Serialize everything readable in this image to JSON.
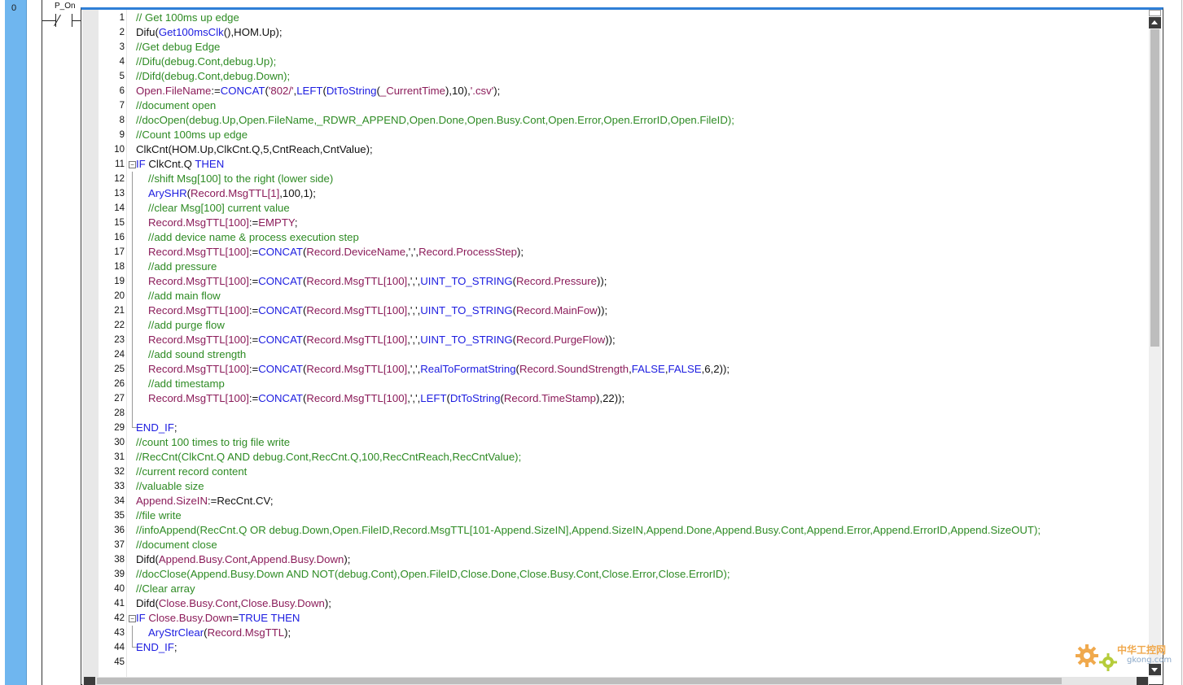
{
  "rung": {
    "number": "0",
    "contact_label": "P_On"
  },
  "colors": {
    "comment": "#2e8b24",
    "keyword": "#1d1de0",
    "variable": "#8b1c5a",
    "rung_bar": "#6fb6ef",
    "editor_border": "#2f7fd7"
  },
  "watermark": {
    "line1": "中华工控网",
    "line2": "gkong.com"
  },
  "code_lines": [
    {
      "n": "1",
      "ind": 0,
      "tk": [
        [
          "c",
          "// Get 100ms up edge"
        ]
      ]
    },
    {
      "n": "2",
      "ind": 0,
      "tk": [
        [
          "p",
          "Difu("
        ],
        [
          "k",
          "Get100msClk"
        ],
        [
          "p",
          "(),HOM.Up);"
        ]
      ]
    },
    {
      "n": "3",
      "ind": 0,
      "tk": [
        [
          "c",
          "//Get debug Edge"
        ]
      ]
    },
    {
      "n": "4",
      "ind": 0,
      "tk": [
        [
          "c",
          "//Difu(debug.Cont,debug.Up);"
        ]
      ]
    },
    {
      "n": "5",
      "ind": 0,
      "tk": [
        [
          "c",
          "//Difd(debug.Cont,debug.Down);"
        ]
      ]
    },
    {
      "n": "6",
      "ind": 0,
      "tk": [
        [
          "v",
          "Open.FileName"
        ],
        [
          "p",
          ":="
        ],
        [
          "k",
          "CONCAT"
        ],
        [
          "p",
          "("
        ],
        [
          "s",
          "'802/'"
        ],
        [
          "p",
          ","
        ],
        [
          "k",
          "LEFT"
        ],
        [
          "p",
          "("
        ],
        [
          "k",
          "DtToString"
        ],
        [
          "p",
          "("
        ],
        [
          "v",
          "_CurrentTime"
        ],
        [
          "p",
          "),10),"
        ],
        [
          "s",
          "'.csv'"
        ],
        [
          "p",
          ");"
        ]
      ]
    },
    {
      "n": "7",
      "ind": 0,
      "tk": [
        [
          "c",
          "//document open"
        ]
      ]
    },
    {
      "n": "8",
      "ind": 0,
      "tk": [
        [
          "c",
          "//docOpen(debug.Up,Open.FileName,_RDWR_APPEND,Open.Done,Open.Busy.Cont,Open.Error,Open.ErrorID,Open.FileID);"
        ]
      ]
    },
    {
      "n": "9",
      "ind": 0,
      "tk": [
        [
          "c",
          "//Count 100ms up edge"
        ]
      ]
    },
    {
      "n": "10",
      "ind": 0,
      "tk": [
        [
          "p",
          "ClkCnt(HOM.Up,ClkCnt.Q,5,CntReach,CntValue);"
        ]
      ]
    },
    {
      "n": "11",
      "ind": 0,
      "fold": "start",
      "tk": [
        [
          "k",
          "IF "
        ],
        [
          "p",
          "ClkCnt.Q "
        ],
        [
          "k",
          "THEN"
        ]
      ]
    },
    {
      "n": "12",
      "ind": 1,
      "fold": "mid",
      "tk": [
        [
          "c",
          "//shift Msg[100] to the right (lower side)"
        ]
      ]
    },
    {
      "n": "13",
      "ind": 1,
      "fold": "mid",
      "tk": [
        [
          "k",
          "ArySHR"
        ],
        [
          "p",
          "("
        ],
        [
          "v",
          "Record.MsgTTL[1]"
        ],
        [
          "p",
          ",100,1);"
        ]
      ]
    },
    {
      "n": "14",
      "ind": 1,
      "fold": "mid",
      "tk": [
        [
          "c",
          "//clear Msg[100] current value"
        ]
      ]
    },
    {
      "n": "15",
      "ind": 1,
      "fold": "mid",
      "tk": [
        [
          "v",
          "Record.MsgTTL[100]"
        ],
        [
          "p",
          ":="
        ],
        [
          "v",
          "EMPTY"
        ],
        [
          "p",
          ";"
        ]
      ]
    },
    {
      "n": "16",
      "ind": 1,
      "fold": "mid",
      "tk": [
        [
          "c",
          "//add device name & process execution step"
        ]
      ]
    },
    {
      "n": "17",
      "ind": 1,
      "fold": "mid",
      "tk": [
        [
          "v",
          "Record.MsgTTL[100]"
        ],
        [
          "p",
          ":="
        ],
        [
          "k",
          "CONCAT"
        ],
        [
          "p",
          "("
        ],
        [
          "v",
          "Record.DeviceName"
        ],
        [
          "p",
          ",',',"
        ],
        [
          "v",
          "Record.ProcessStep"
        ],
        [
          "p",
          ");"
        ]
      ]
    },
    {
      "n": "18",
      "ind": 1,
      "fold": "mid",
      "tk": [
        [
          "c",
          "//add pressure"
        ]
      ]
    },
    {
      "n": "19",
      "ind": 1,
      "fold": "mid",
      "tk": [
        [
          "v",
          "Record.MsgTTL[100]"
        ],
        [
          "p",
          ":="
        ],
        [
          "k",
          "CONCAT"
        ],
        [
          "p",
          "("
        ],
        [
          "v",
          "Record.MsgTTL[100]"
        ],
        [
          "p",
          ",',',"
        ],
        [
          "k",
          "UINT_TO_STRING"
        ],
        [
          "p",
          "("
        ],
        [
          "v",
          "Record.Pressure"
        ],
        [
          "p",
          "));"
        ]
      ]
    },
    {
      "n": "20",
      "ind": 1,
      "fold": "mid",
      "tk": [
        [
          "c",
          "//add main flow"
        ]
      ]
    },
    {
      "n": "21",
      "ind": 1,
      "fold": "mid",
      "tk": [
        [
          "v",
          "Record.MsgTTL[100]"
        ],
        [
          "p",
          ":="
        ],
        [
          "k",
          "CONCAT"
        ],
        [
          "p",
          "("
        ],
        [
          "v",
          "Record.MsgTTL[100]"
        ],
        [
          "p",
          ",',',"
        ],
        [
          "k",
          "UINT_TO_STRING"
        ],
        [
          "p",
          "("
        ],
        [
          "v",
          "Record.MainFow"
        ],
        [
          "p",
          "));"
        ]
      ]
    },
    {
      "n": "22",
      "ind": 1,
      "fold": "mid",
      "tk": [
        [
          "c",
          "//add purge flow"
        ]
      ]
    },
    {
      "n": "23",
      "ind": 1,
      "fold": "mid",
      "tk": [
        [
          "v",
          "Record.MsgTTL[100]"
        ],
        [
          "p",
          ":="
        ],
        [
          "k",
          "CONCAT"
        ],
        [
          "p",
          "("
        ],
        [
          "v",
          "Record.MsgTTL[100]"
        ],
        [
          "p",
          ",',',"
        ],
        [
          "k",
          "UINT_TO_STRING"
        ],
        [
          "p",
          "("
        ],
        [
          "v",
          "Record.PurgeFlow"
        ],
        [
          "p",
          "));"
        ]
      ]
    },
    {
      "n": "24",
      "ind": 1,
      "fold": "mid",
      "tk": [
        [
          "c",
          "//add sound strength"
        ]
      ]
    },
    {
      "n": "25",
      "ind": 1,
      "fold": "mid",
      "tk": [
        [
          "v",
          "Record.MsgTTL[100]"
        ],
        [
          "p",
          ":="
        ],
        [
          "k",
          "CONCAT"
        ],
        [
          "p",
          "("
        ],
        [
          "v",
          "Record.MsgTTL[100]"
        ],
        [
          "p",
          ",',',"
        ],
        [
          "k",
          "RealToFormatString"
        ],
        [
          "p",
          "("
        ],
        [
          "v",
          "Record.SoundStrength"
        ],
        [
          "p",
          ","
        ],
        [
          "k",
          "FALSE"
        ],
        [
          "p",
          ","
        ],
        [
          "k",
          "FALSE"
        ],
        [
          "p",
          ",6,2));"
        ]
      ]
    },
    {
      "n": "26",
      "ind": 1,
      "fold": "mid",
      "tk": [
        [
          "c",
          "//add timestamp"
        ]
      ]
    },
    {
      "n": "27",
      "ind": 1,
      "fold": "mid",
      "tk": [
        [
          "v",
          "Record.MsgTTL[100]"
        ],
        [
          "p",
          ":="
        ],
        [
          "k",
          "CONCAT"
        ],
        [
          "p",
          "("
        ],
        [
          "v",
          "Record.MsgTTL[100]"
        ],
        [
          "p",
          ",',',"
        ],
        [
          "k",
          "LEFT"
        ],
        [
          "p",
          "("
        ],
        [
          "k",
          "DtToString"
        ],
        [
          "p",
          "("
        ],
        [
          "v",
          "Record.TimeStamp"
        ],
        [
          "p",
          "),22));"
        ]
      ]
    },
    {
      "n": "28",
      "ind": 1,
      "fold": "mid",
      "tk": []
    },
    {
      "n": "29",
      "ind": 0,
      "fold": "end",
      "tk": [
        [
          "k",
          "END_IF"
        ],
        [
          "p",
          ";"
        ]
      ]
    },
    {
      "n": "30",
      "ind": 0,
      "tk": [
        [
          "c",
          "//count 100 times to trig file write"
        ]
      ]
    },
    {
      "n": "31",
      "ind": 0,
      "tk": [
        [
          "c",
          "//RecCnt(ClkCnt.Q AND debug.Cont,RecCnt.Q,100,RecCntReach,RecCntValue);"
        ]
      ]
    },
    {
      "n": "32",
      "ind": 0,
      "tk": [
        [
          "c",
          "//current record content"
        ]
      ]
    },
    {
      "n": "33",
      "ind": 0,
      "tk": [
        [
          "c",
          "//valuable size"
        ]
      ]
    },
    {
      "n": "34",
      "ind": 0,
      "tk": [
        [
          "v",
          "Append.SizeIN"
        ],
        [
          "p",
          ":=RecCnt.CV;"
        ]
      ]
    },
    {
      "n": "35",
      "ind": 0,
      "tk": [
        [
          "c",
          "//file write"
        ]
      ]
    },
    {
      "n": "36",
      "ind": 0,
      "tk": [
        [
          "c",
          "//infoAppend(RecCnt.Q OR debug.Down,Open.FileID,Record.MsgTTL[101-Append.SizeIN],Append.SizeIN,Append.Done,Append.Busy.Cont,Append.Error,Append.ErrorID,Append.SizeOUT);"
        ]
      ]
    },
    {
      "n": "37",
      "ind": 0,
      "tk": [
        [
          "c",
          "//document close"
        ]
      ]
    },
    {
      "n": "38",
      "ind": 0,
      "tk": [
        [
          "p",
          "Difd("
        ],
        [
          "v",
          "Append.Busy.Cont"
        ],
        [
          "p",
          ","
        ],
        [
          "v",
          "Append.Busy.Down"
        ],
        [
          "p",
          ");"
        ]
      ]
    },
    {
      "n": "39",
      "ind": 0,
      "tk": [
        [
          "c",
          "//docClose(Append.Busy.Down AND NOT(debug.Cont),Open.FileID,Close.Done,Close.Busy.Cont,Close.Error,Close.ErrorID);"
        ]
      ]
    },
    {
      "n": "40",
      "ind": 0,
      "tk": [
        [
          "c",
          "//Clear array"
        ]
      ]
    },
    {
      "n": "41",
      "ind": 0,
      "tk": [
        [
          "p",
          "Difd("
        ],
        [
          "v",
          "Close.Busy.Cont"
        ],
        [
          "p",
          ","
        ],
        [
          "v",
          "Close.Busy.Down"
        ],
        [
          "p",
          ");"
        ]
      ]
    },
    {
      "n": "42",
      "ind": 0,
      "fold": "start",
      "tk": [
        [
          "k",
          "IF "
        ],
        [
          "v",
          "Close.Busy.Down"
        ],
        [
          "p",
          "="
        ],
        [
          "k",
          "TRUE THEN"
        ]
      ]
    },
    {
      "n": "43",
      "ind": 1,
      "fold": "mid",
      "tk": [
        [
          "k",
          "AryStrClear"
        ],
        [
          "p",
          "("
        ],
        [
          "v",
          "Record.MsgTTL"
        ],
        [
          "p",
          ");"
        ]
      ]
    },
    {
      "n": "44",
      "ind": 0,
      "fold": "end",
      "tk": [
        [
          "k",
          "END_IF"
        ],
        [
          "p",
          ";"
        ]
      ]
    },
    {
      "n": "45",
      "ind": 0,
      "tk": []
    }
  ]
}
